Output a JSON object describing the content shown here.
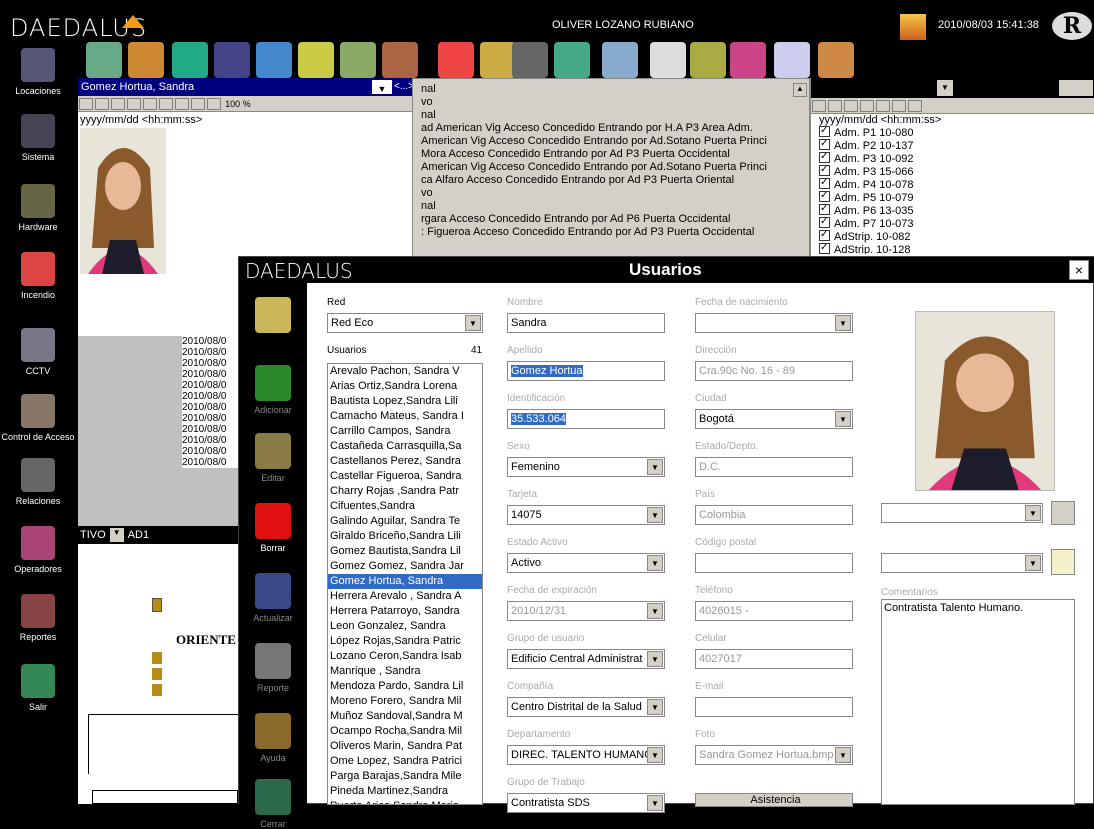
{
  "topbar": {
    "brand": "DAEDALUS",
    "user": "OLIVER LOZANO RUBIANO",
    "datetime": "2010/08/03 15:41:38",
    "logo": "R",
    "tools": [
      "grid-icon",
      "gear-icon",
      "monitor-icon",
      "cable-icon",
      "display-icon",
      "bulb-icon",
      "map-icon",
      "door-icon",
      "fire-icon",
      "person-icon",
      "card-icon",
      "globe-icon",
      "camera-icon",
      "walker-icon",
      "video-icon",
      "visitor-icon",
      "report-icon",
      "refresh-icon"
    ]
  },
  "nav": [
    {
      "label": "Locaciones",
      "icon": "building-icon"
    },
    {
      "label": "Sistema",
      "icon": "computer-icon"
    },
    {
      "label": "Hardware",
      "icon": "hardware-icon"
    },
    {
      "label": "Incendio",
      "icon": "fire-icon"
    },
    {
      "label": "CCTV",
      "icon": "camera-icon"
    },
    {
      "label": "Control de Acceso",
      "icon": "door-icon"
    },
    {
      "label": "Relaciones",
      "icon": "relations-icon"
    },
    {
      "label": "Operadores",
      "icon": "operators-icon"
    },
    {
      "label": "Reportes",
      "icon": "reports-icon"
    },
    {
      "label": "Salir",
      "icon": "exit-icon"
    }
  ],
  "leftpanel": {
    "title": "Gomez Hortua,  Sandra",
    "combo": "<...>",
    "zoom": "100 %",
    "format": "yyyy/mm/dd <hh:mm:ss>",
    "dates": [
      "2010/08/0",
      "2010/08/0",
      "2010/08/0",
      "2010/08/0",
      "2010/08/0",
      "2010/08/0",
      "2010/08/0",
      "2010/08/0",
      "2010/08/0",
      "2010/08/0",
      "2010/08/0",
      "2010/08/0"
    ],
    "sel1": "TIVO",
    "sel2": "AD1",
    "map_label": "ORIENTE"
  },
  "log": [
    "nal",
    "vo",
    "nal",
    "ad American Vig Acceso Concedido Entrando por H.A P3 Area Adm.",
    "American Vig Acceso Concedido Entrando por Ad.Sotano Puerta Princi",
    "Mora Acceso Concedido Entrando por Ad P3 Puerta Occidental",
    "American Vig Acceso Concedido Entrando por Ad.Sotano Puerta Princi",
    "ca Alfaro Acceso Concedido Entrando por Ad P3 Puerta Oriental",
    "vo",
    "nal",
    "rgara Acceso Concedido Entrando por Ad P6 Puerta Occidental",
    ": Figueroa Acceso Concedido Entrando por Ad P3 Puerta Occidental"
  ],
  "rightpanel": {
    "format": "yyyy/mm/dd <hh:mm:ss>",
    "items": [
      "Adm. P1 10-080",
      "Adm. P2 10-137",
      "Adm. P3 10-092",
      "Adm. P3 15-066",
      "Adm. P4 10-078",
      "Adm. P5 10-079",
      "Adm. P6 13-035",
      "Adm. P7 10-073",
      "AdStrip. 10-082",
      "AdStrip. 10-128"
    ]
  },
  "dialog": {
    "brand": "DAEDALUS",
    "title": "Usuarios",
    "close": "×",
    "side": [
      {
        "label": "",
        "icon": "id-card-icon",
        "on": true
      },
      {
        "label": "Adicionar",
        "icon": "add-icon",
        "on": false
      },
      {
        "label": "Editar",
        "icon": "pencil-icon",
        "on": false
      },
      {
        "label": "Borrar",
        "icon": "delete-icon",
        "on": true
      },
      {
        "label": "Actualizar",
        "icon": "update-icon",
        "on": false
      },
      {
        "label": "Reporte",
        "icon": "report-icon",
        "on": false
      },
      {
        "label": "Ayuda",
        "icon": "help-icon",
        "on": false
      },
      {
        "label": "Cerrar",
        "icon": "exit-icon",
        "on": false
      }
    ],
    "red_label": "Red",
    "red_value": "Red Eco",
    "users_label": "Usuarios",
    "users_count": "41",
    "users": [
      "Arevalo Pachon, Sandra V",
      "Arias Ortiz,Sandra Lorena",
      "Bautista Lopez,Sandra Lili",
      "Camacho Mateus, Sandra I",
      "Carrillo Campos, Sandra",
      "Castañeda Carrasquilla,Sa",
      "Castellanos Perez, Sandra",
      "Castellar Figueroa, Sandra",
      "Charry Rojas ,Sandra Patr",
      "Cifuentes,Sandra",
      "Galindo Aguilar, Sandra Te",
      "Giraldo Briceño,Sandra Lili",
      "Gomez Bautista,Sandra Lil",
      "Gomez Gomez, Sandra Jar",
      "Gomez Hortua, Sandra",
      "Herrera Arevalo , Sandra A",
      "Herrera Patarroyo, Sandra",
      "Leon Gonzalez, Sandra",
      "López Rojas,Sandra Patric",
      "Lozano Ceron,Sandra Isab",
      "Manrique , Sandra",
      "Mendoza Pardo, Sandra Lil",
      "Moreno Forero, Sandra Mil",
      "Muñoz Sandoval,Sandra M",
      "Ocampo Rocha,Sandra Mil",
      "Oliveros Marin, Sandra Pat",
      "Ome Lopez, Sandra Patrici",
      "Parga Barajas,Sandra Mile",
      "Pineda Martinez,Sandra",
      "Puerto Arias,Sandra Maria"
    ],
    "selected_user": 14,
    "fields": {
      "nombre_l": "Nombre",
      "nombre": "Sandra",
      "apellido_l": "Apellido",
      "apellido": "Gomez Hortua",
      "ident_l": "Identificación",
      "ident": "35.533.064",
      "sexo_l": "Sexo",
      "sexo": "Femenino",
      "tarjeta_l": "Tarjeta",
      "tarjeta": "14075",
      "estado_l": "Estado Activo",
      "estado": "Activo",
      "fexp_l": "Fecha de expiración",
      "fexp": "2010/12/31",
      "grupo_l": "Grupo de usuario",
      "grupo": "Edificio Central Administrat",
      "compania_l": "Compañía",
      "compania": "Centro Distrital de la Salud",
      "depto_l": "Departamento",
      "depto": "DIREC. TALENTO HUMANO",
      "gtrab_l": "Grupo de Trabajo",
      "gtrab": "Contratista SDS",
      "fnac_l": "Fecha de nacimiento",
      "fnac": "",
      "dir_l": "Dirección",
      "dir": "Cra.90c No. 16 - 89",
      "ciudad_l": "Ciudad",
      "ciudad": "Bogotá",
      "estdep_l": "Estado/Depto.",
      "estdep": "D.C.",
      "pais_l": "País",
      "pais": "Colombia",
      "cp_l": "Código postal",
      "cp": "",
      "tel_l": "Teléfono",
      "tel": "4026015 -",
      "cel_l": "Celular",
      "cel": "4027017",
      "email_l": "E-mail",
      "email": "",
      "foto_l": "Foto",
      "foto": "Sandra Gomez Hortua.bmp",
      "coment_l": "Comentarios",
      "coment": "Contratista Talento Humano.",
      "asistencia": "Asistencia"
    }
  }
}
